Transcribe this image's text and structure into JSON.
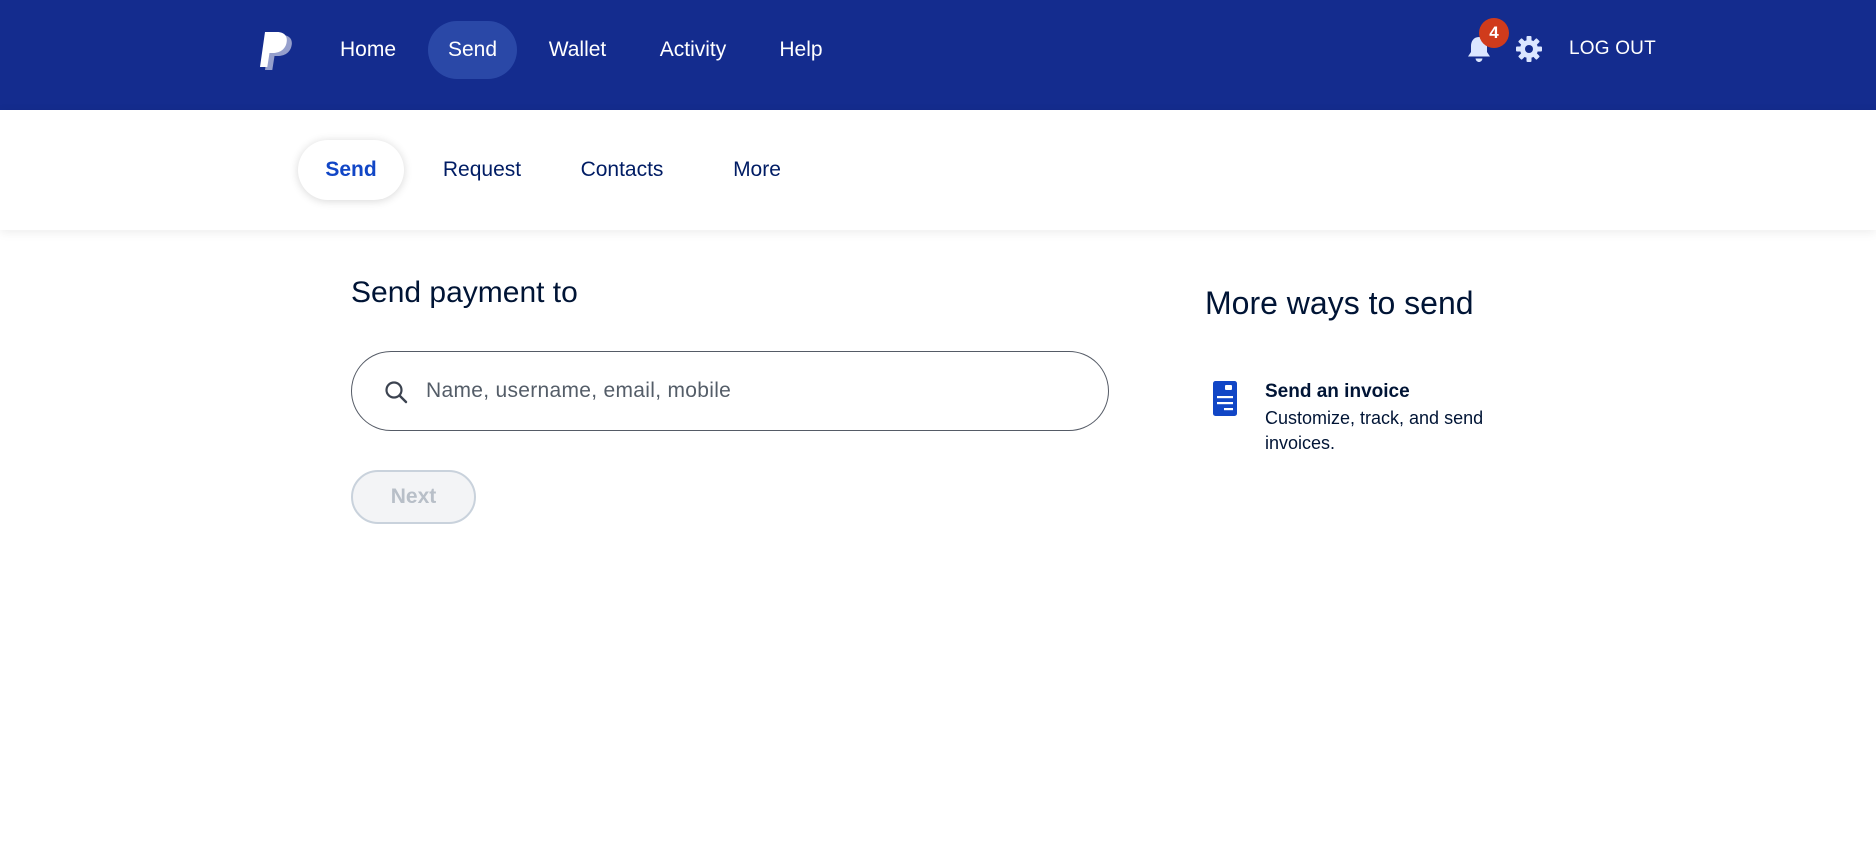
{
  "topnav": {
    "items": [
      {
        "label": "Home",
        "active": false
      },
      {
        "label": "Send",
        "active": true
      },
      {
        "label": "Wallet",
        "active": false
      },
      {
        "label": "Activity",
        "active": false
      },
      {
        "label": "Help",
        "active": false
      }
    ],
    "notification_count": "4",
    "logout_label": "LOG OUT",
    "colors": {
      "background": "#142c8e",
      "active_pill": "#2a48a7",
      "badge": "#d03b1c"
    }
  },
  "subnav": {
    "items": [
      {
        "label": "Send",
        "active": true
      },
      {
        "label": "Request",
        "active": false
      },
      {
        "label": "Contacts",
        "active": false
      },
      {
        "label": "More",
        "active": false
      }
    ]
  },
  "main": {
    "heading": "Send payment to",
    "search": {
      "placeholder": "Name, username, email, mobile",
      "value": ""
    },
    "next_label": "Next",
    "next_disabled": true
  },
  "sidebar": {
    "heading": "More ways to send",
    "options": [
      {
        "icon": "invoice-icon",
        "title": "Send an invoice",
        "description": "Customize, track, and send invoices."
      }
    ]
  }
}
